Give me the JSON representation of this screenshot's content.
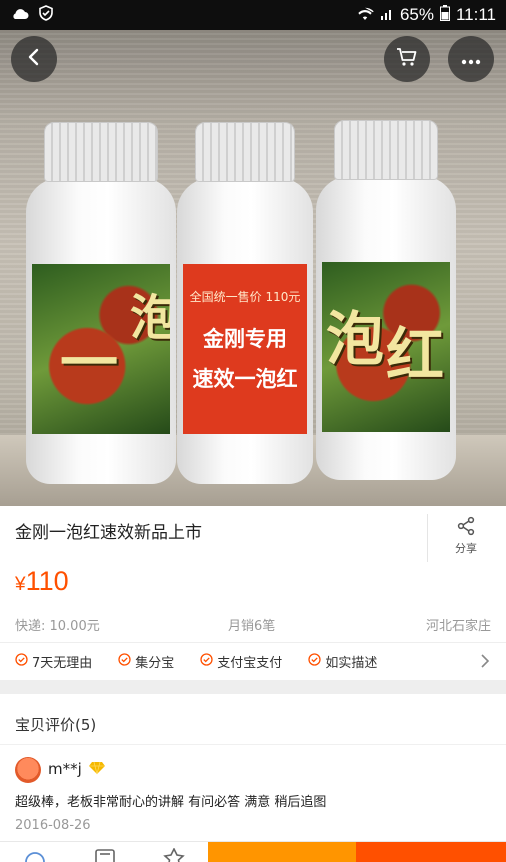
{
  "status_bar": {
    "battery": "65%",
    "time": "11:11",
    "icons": [
      "weather-cloud-icon",
      "shield-icon",
      "wifi-icon",
      "signal-icon",
      "battery-icon"
    ]
  },
  "product": {
    "label_center": {
      "line1": "全国统一售价 110元",
      "line2": "金刚专用",
      "line3": "速效一泡红"
    },
    "label_side_chars": [
      "一",
      "泡",
      "泡",
      "红"
    ],
    "title": "金刚一泡红速效新品上市",
    "share_label": "分享",
    "price_symbol": "¥",
    "price": "110",
    "shipping": "快递: 10.00元",
    "monthly_sales": "月销6笔",
    "location": "河北石家庄"
  },
  "carousel": {
    "total": 2,
    "active_index": 0
  },
  "guarantees": [
    "7天无理由",
    "集分宝",
    "支付宝支付",
    "如实描述"
  ],
  "reviews": {
    "header": "宝贝评价(5)",
    "items": [
      {
        "user": "m**j",
        "text": "超级棒，老板非常耐心的讲解 有问必答 满意 稍后追图",
        "date": "2016-08-26"
      }
    ]
  },
  "colors": {
    "accent": "#ff5000",
    "cart_orange": "#ff9500",
    "guarantee_icon": "#ff5000"
  }
}
